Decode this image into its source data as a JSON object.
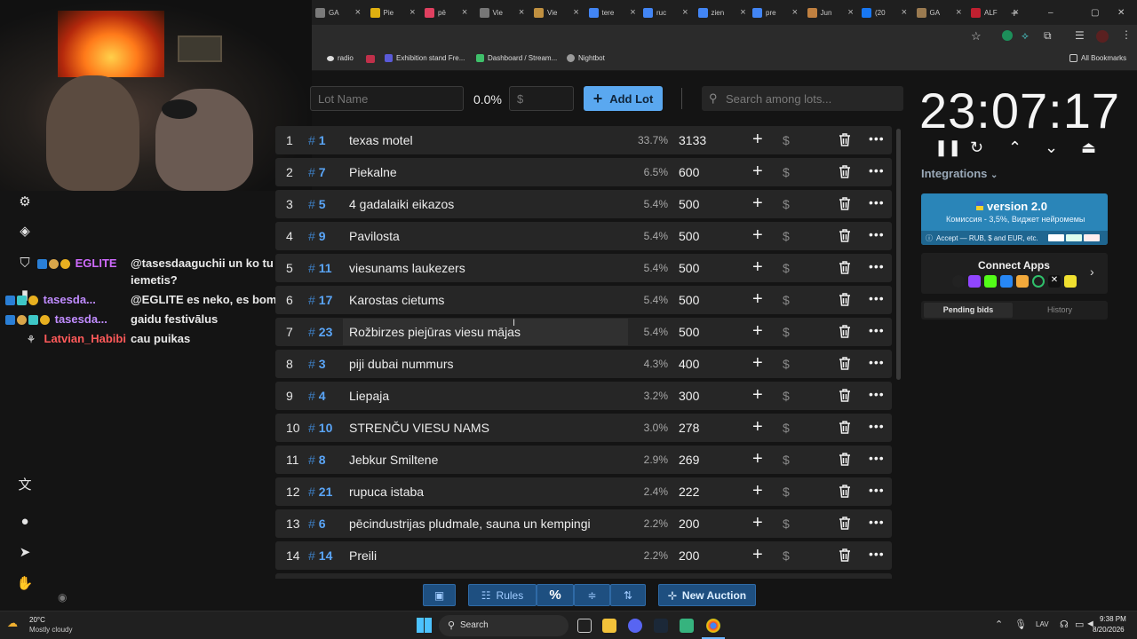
{
  "browser": {
    "tabs": [
      "GA",
      "Pie",
      "pē",
      "Vie",
      "Vie",
      "tere",
      "ruc",
      "zien",
      "pre",
      "Jun",
      "(20",
      "GA",
      "ALF"
    ],
    "bookmarks": [
      "radio",
      "Exhibition stand Fre...",
      "Dashboard / Stream...",
      "Nightbot",
      "All Bookmarks"
    ]
  },
  "chat": [
    {
      "user": "EGLITE",
      "message": "@tasesdaaguchii un ko tu esi",
      "message2": "iemetis?"
    },
    {
      "user": "tasesda...",
      "message": "@EGLITE es neko, es bomzis esmu"
    },
    {
      "user": "tasesda...",
      "message": "gaidu festivālus"
    },
    {
      "user": "Latvian_Habibi",
      "message": "cau puikas"
    }
  ],
  "toolbar": {
    "lot_name_placeholder": "Lot Name",
    "percent": "0.0%",
    "amount_placeholder": "$",
    "add_lot": "Add Lot",
    "search_placeholder": "Search among lots..."
  },
  "lots": [
    {
      "rank": "1",
      "id": "1",
      "name": "texas motel",
      "pct": "33.7%",
      "amount": "3133"
    },
    {
      "rank": "2",
      "id": "7",
      "name": "Piekalne",
      "pct": "6.5%",
      "amount": "600"
    },
    {
      "rank": "3",
      "id": "5",
      "name": "4 gadalaiki eikazos",
      "pct": "5.4%",
      "amount": "500"
    },
    {
      "rank": "4",
      "id": "9",
      "name": "Pavilosta",
      "pct": "5.4%",
      "amount": "500"
    },
    {
      "rank": "5",
      "id": "11",
      "name": " viesunams laukezers",
      "pct": "5.4%",
      "amount": "500"
    },
    {
      "rank": "6",
      "id": "17",
      "name": "Karostas cietums",
      "pct": "5.4%",
      "amount": "500"
    },
    {
      "rank": "7",
      "id": "23",
      "name": "Rožbirzes piejūras viesu mājas",
      "pct": "5.4%",
      "amount": "500"
    },
    {
      "rank": "8",
      "id": "3",
      "name": "piji dubai nummurs",
      "pct": "4.3%",
      "amount": "400"
    },
    {
      "rank": "9",
      "id": "4",
      "name": "Liepaja",
      "pct": "3.2%",
      "amount": "300"
    },
    {
      "rank": "10",
      "id": "10",
      "name": "STRENČU VIESU NAMS",
      "pct": "3.0%",
      "amount": "278"
    },
    {
      "rank": "11",
      "id": "8",
      "name": "Jebkur Smiltene",
      "pct": "2.9%",
      "amount": "269"
    },
    {
      "rank": "12",
      "id": "21",
      "name": "rupuca istaba",
      "pct": "2.4%",
      "amount": "222"
    },
    {
      "rank": "13",
      "id": "6",
      "name": "pēcindustrijas pludmale, sauna un kempingi",
      "pct": "2.2%",
      "amount": "200"
    },
    {
      "rank": "14",
      "id": "14",
      "name": "Preili",
      "pct": "2.2%",
      "amount": "200"
    }
  ],
  "bottom": {
    "rules": "Rules",
    "new_auction": "New Auction"
  },
  "right": {
    "timer": "23:07:17",
    "integrations": "Integrations",
    "version": "version 2.0",
    "version_sub": "Комиссия - 3,5%, Виджет нейромемы",
    "accept": "Accept — RUB, $ and EUR, etc.",
    "connect": "Connect Apps",
    "tab_pending": "Pending bids",
    "tab_history": "History"
  },
  "taskbar": {
    "temp": "20°C",
    "weather": "Mostly cloudy",
    "search": "Search",
    "lang": "LAV",
    "time": "9:38 PM",
    "date": "8/20/2026"
  },
  "colors": {
    "accent": "#1f6fb8",
    "add_lot": "#5aa8f0",
    "id": "#5aa5f7"
  }
}
